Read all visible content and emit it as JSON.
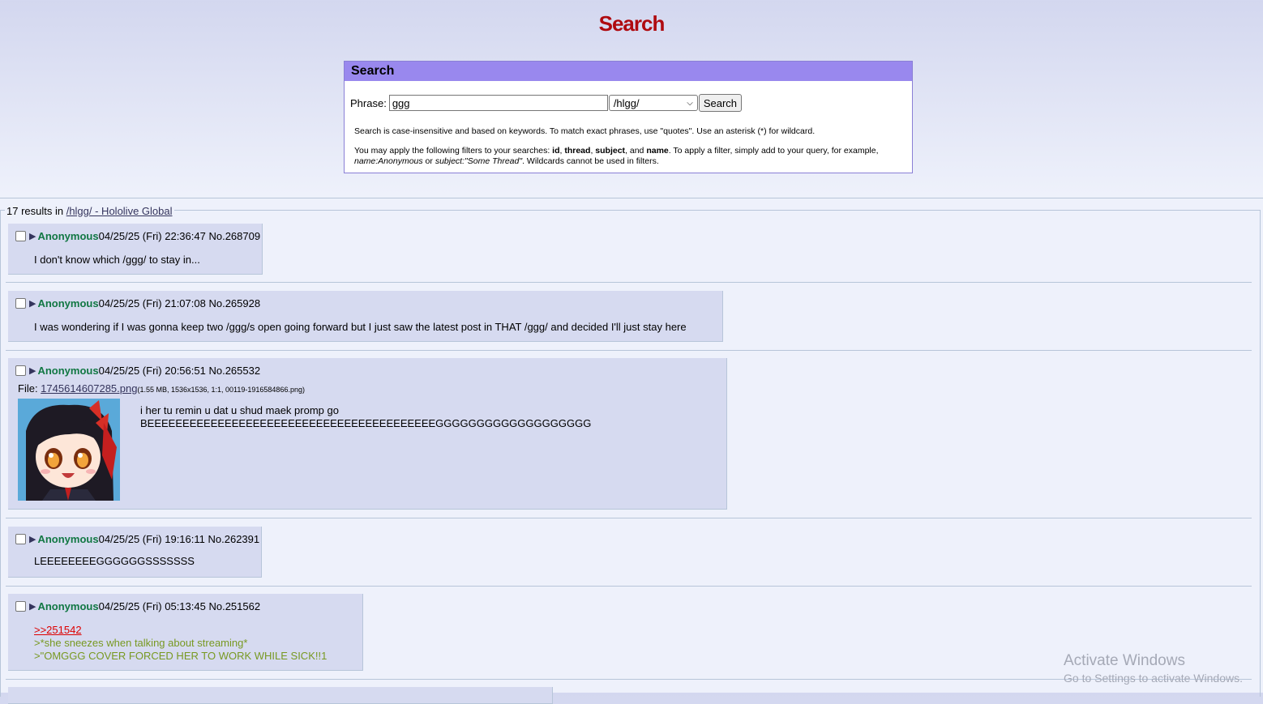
{
  "page": {
    "title": "Search"
  },
  "search_box": {
    "header": "Search",
    "phrase_label": "Phrase:",
    "phrase_value": "ggg",
    "board_selected": "/hlgg/",
    "button_label": "Search",
    "help1": "Search is case-insensitive and based on keywords. To match exact phrases, use \"quotes\". Use an asterisk (*) for wildcard.",
    "help2_prefix": "You may apply the following filters to your searches: ",
    "help2_f1": "id",
    "help2_f2": "thread",
    "help2_f3": "subject",
    "help2_and": ", and ",
    "help2_f4": "name",
    "help2_mid": ". To apply a filter, simply add to your query, for example, ",
    "help2_ex1": "name:Anonymous",
    "help2_or": " or ",
    "help2_ex2": "subject:\"Some Thread\"",
    "help2_suffix": ". Wildcards cannot be used in filters."
  },
  "results": {
    "count_text": "17 results in ",
    "board_link": "/hlgg/ - Hololive Global",
    "posts": [
      {
        "name": "Anonymous",
        "datetime": "04/25/25 (Fri) 22:36:47",
        "number": "No.268709",
        "body": "I don't know which /ggg/ to stay in..."
      },
      {
        "name": "Anonymous",
        "datetime": "04/25/25 (Fri) 21:07:08",
        "number": "No.265928",
        "body": "I was wondering if I was gonna keep two /ggg/s open going forward but I just saw the latest post in THAT /ggg/ and decided I'll just stay here"
      },
      {
        "name": "Anonymous",
        "datetime": "04/25/25 (Fri) 20:56:51",
        "number": "No.265532",
        "file_label": "File: ",
        "file_name": "1745614607285.png",
        "file_info": "(1.55 MB, 1536x1536, 1:1, 00119-1916584866.png)",
        "body_line1": "i her tu remin u dat u shud maek promp go",
        "body_line2": "BEEEEEEEEEEEEEEEEEEEEEEEEEEEEEEEEEEEEEEEEEGGGGGGGGGGGGGGGGGGG"
      },
      {
        "name": "Anonymous",
        "datetime": "04/25/25 (Fri) 19:16:11",
        "number": "No.262391",
        "body": "LEEEEEEEEGGGGGGSSSSSSS"
      },
      {
        "name": "Anonymous",
        "datetime": "04/25/25 (Fri) 05:13:45",
        "number": "No.251562",
        "quote_link": ">>251542",
        "green1": ">*she sneezes when talking about streaming*",
        "green2": ">\"OMGGG COVER FORCED HER TO WORK WHILE SICK!!1"
      }
    ]
  },
  "watermark": {
    "line1": "Activate Windows",
    "line2": "Go to Settings to activate Windows."
  },
  "colors": {
    "title": "#af0a0f",
    "name": "#117743",
    "post_bg": "#d6daf0",
    "header_bar": "#9988ee",
    "greentext": "#789922",
    "quotelink": "#dd0000"
  }
}
